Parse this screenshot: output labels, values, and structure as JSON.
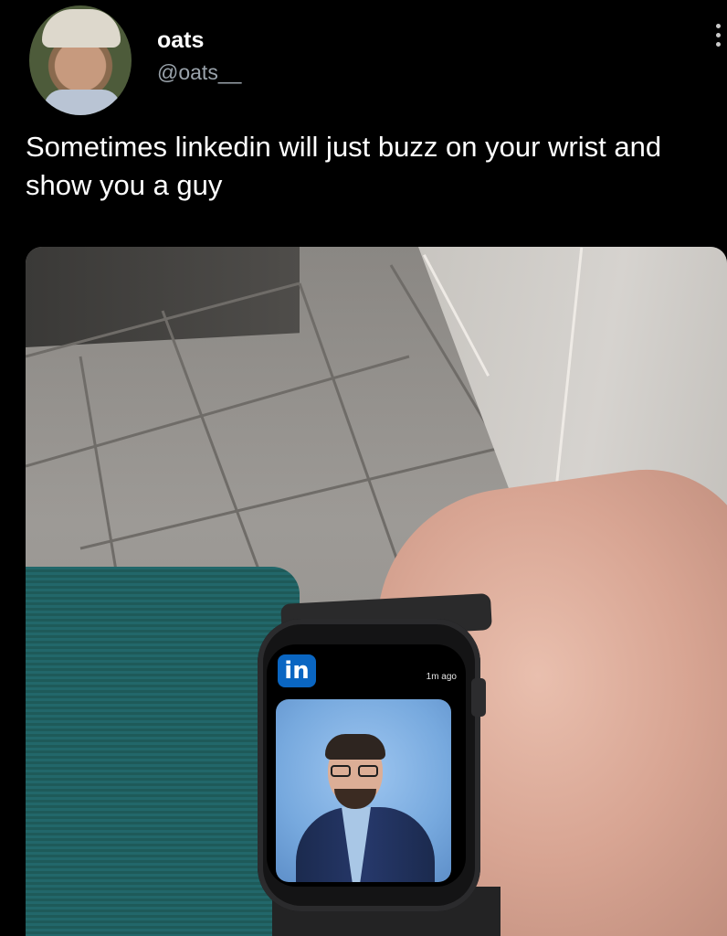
{
  "author": {
    "display_name": "oats",
    "handle": "@oats__"
  },
  "tweet": {
    "text": "Sometimes linkedin will just buzz on your wrist and show you a guy"
  },
  "media": {
    "watch_notification": {
      "app_badge": "in",
      "time": "1m ago"
    }
  },
  "colors": {
    "background": "#000000",
    "handle_text": "#9aa3ab",
    "linkedin_blue": "#0a66c2"
  }
}
